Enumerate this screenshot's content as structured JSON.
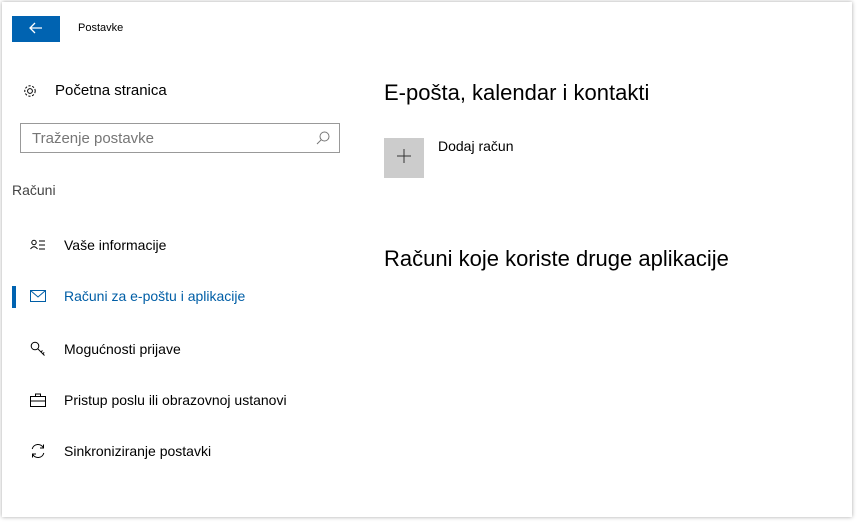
{
  "window": {
    "title": "Postavke",
    "back_icon": "back-arrow-icon"
  },
  "sidebar": {
    "home_label": "Početna stranica",
    "search_placeholder": "Traženje postavke",
    "section_header": "Računi",
    "items": [
      {
        "label": "Vaše informacije",
        "icon": "person-info-icon",
        "active": false
      },
      {
        "label": "Računi za e-poštu i aplikacije",
        "icon": "mail-icon",
        "active": true
      },
      {
        "label": "Mogućnosti prijave",
        "icon": "key-icon",
        "active": false
      },
      {
        "label": "Pristup poslu ili obrazovnoj ustanovi",
        "icon": "briefcase-icon",
        "active": false
      },
      {
        "label": "Sinkroniziranje postavki",
        "icon": "sync-icon",
        "active": false
      }
    ]
  },
  "main": {
    "title": "E-pošta, kalendar i kontakti",
    "add_account_label": "Dodaj račun",
    "other_apps_title": "Računi koje koriste druge aplikacije"
  },
  "colors": {
    "accent": "#0063b1",
    "active_text": "#005ea6",
    "tile_bg": "#cccccc"
  }
}
